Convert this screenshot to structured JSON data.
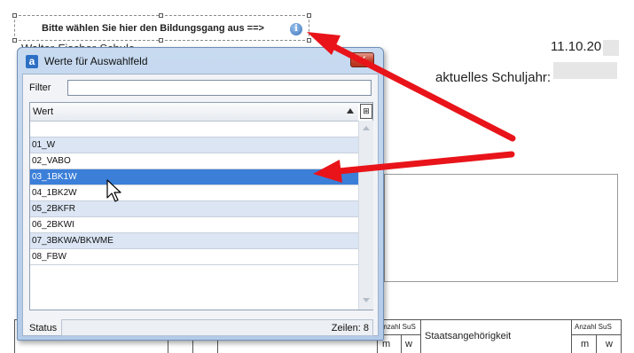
{
  "document": {
    "selector_label": "Bitte wählen Sie hier den Bildungsgang aus ==>",
    "info_icon_glyph": "i",
    "partial_text": "Walter-Fischer-Schule",
    "date": "11.10.20",
    "schoolyear_label": "aktuelles Schuljahr:",
    "table": {
      "left_small_header": "Anzahl SuS",
      "left_m": "m",
      "left_w": "w",
      "middle_header": "Staatsangehörigkeit",
      "right_small_header": "Anzahl SuS",
      "right_m": "m",
      "right_w": "w"
    }
  },
  "dialog": {
    "app_icon": "a",
    "title": "Werte für Auswahlfeld",
    "close_glyph": "✕",
    "filter_label": "Filter",
    "filter_value": "",
    "column_header": "Wert",
    "column_chooser_icon": "⊞",
    "rows": [
      {
        "label": "",
        "state": "blank"
      },
      {
        "label": "01_W",
        "state": "alt"
      },
      {
        "label": "02_VABO",
        "state": "normal"
      },
      {
        "label": "03_1BK1W",
        "state": "selected"
      },
      {
        "label": "04_1BK2W",
        "state": "normal"
      },
      {
        "label": "05_2BKFR",
        "state": "alt"
      },
      {
        "label": "06_2BKWI",
        "state": "normal"
      },
      {
        "label": "07_3BKWA/BKWME",
        "state": "alt"
      },
      {
        "label": "08_FBW",
        "state": "normal"
      }
    ],
    "status_label": "Status",
    "row_count": "Zeilen: 8"
  },
  "colors": {
    "arrow": "#e8141a",
    "selected_row": "#3b7fd9",
    "alt_row": "#dbe5f4"
  },
  "icons": {
    "info": "info-icon",
    "close": "close-icon",
    "sort": "sort-ascending-icon",
    "column_chooser": "column-chooser-icon",
    "cursor": "mouse-pointer-icon"
  }
}
